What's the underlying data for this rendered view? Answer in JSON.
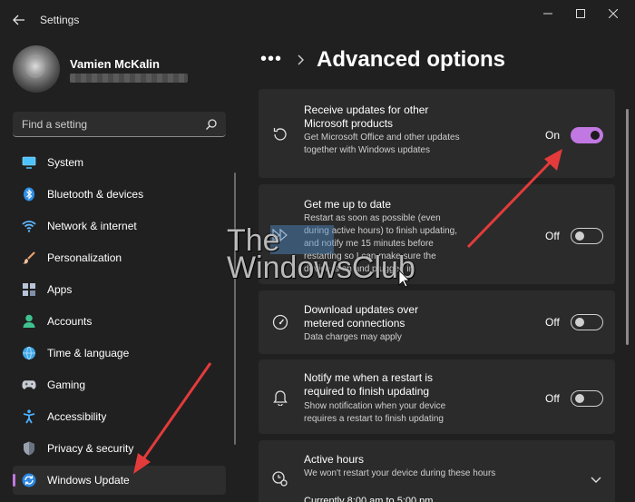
{
  "window": {
    "title": "Settings",
    "colors": {
      "background": "#202020",
      "card": "#2b2b2b",
      "accent": "#c278e2",
      "arrow": "#e33b3b"
    }
  },
  "profile": {
    "name": "Vamien McKalin"
  },
  "search": {
    "placeholder": "Find a setting"
  },
  "sidebar": {
    "items": [
      {
        "label": "System",
        "icon": "monitor-icon"
      },
      {
        "label": "Bluetooth & devices",
        "icon": "bluetooth-icon"
      },
      {
        "label": "Network & internet",
        "icon": "wifi-icon"
      },
      {
        "label": "Personalization",
        "icon": "brush-icon"
      },
      {
        "label": "Apps",
        "icon": "apps-grid-icon"
      },
      {
        "label": "Accounts",
        "icon": "person-icon"
      },
      {
        "label": "Time & language",
        "icon": "globe-icon"
      },
      {
        "label": "Gaming",
        "icon": "gamepad-icon"
      },
      {
        "label": "Accessibility",
        "icon": "accessibility-icon"
      },
      {
        "label": "Privacy & security",
        "icon": "shield-icon"
      },
      {
        "label": "Windows Update",
        "icon": "sync-icon",
        "active": true
      }
    ]
  },
  "header": {
    "more": "•••",
    "title": "Advanced options"
  },
  "cards": [
    {
      "title": "Receive updates for other Microsoft products",
      "desc": "Get Microsoft Office and other updates together with Windows updates",
      "toggle_label": "On",
      "state": "on",
      "icon": "refresh-icon"
    },
    {
      "title": "Get me up to date",
      "desc": "Restart as soon as possible (even during active hours) to finish updating, and notify me 15 minutes before restarting so I can make sure the device is on and plugged in",
      "toggle_label": "Off",
      "state": "off",
      "icon": "fast-forward-icon"
    },
    {
      "title": "Download updates over metered connections",
      "desc": "Data charges may apply",
      "toggle_label": "Off",
      "state": "off",
      "icon": "gauge-icon"
    },
    {
      "title": "Notify me when a restart is required to finish updating",
      "desc": "Show notification when your device requires a restart to finish updating",
      "toggle_label": "Off",
      "state": "off",
      "icon": "bell-icon"
    },
    {
      "title": "Active hours",
      "desc": "We won't restart your device during these hours",
      "extra": "Currently 8:00 am to 5:00 pm",
      "icon": "clock-gear-icon"
    }
  ],
  "watermark": {
    "line1": "The",
    "line2": "WindowsClub"
  }
}
